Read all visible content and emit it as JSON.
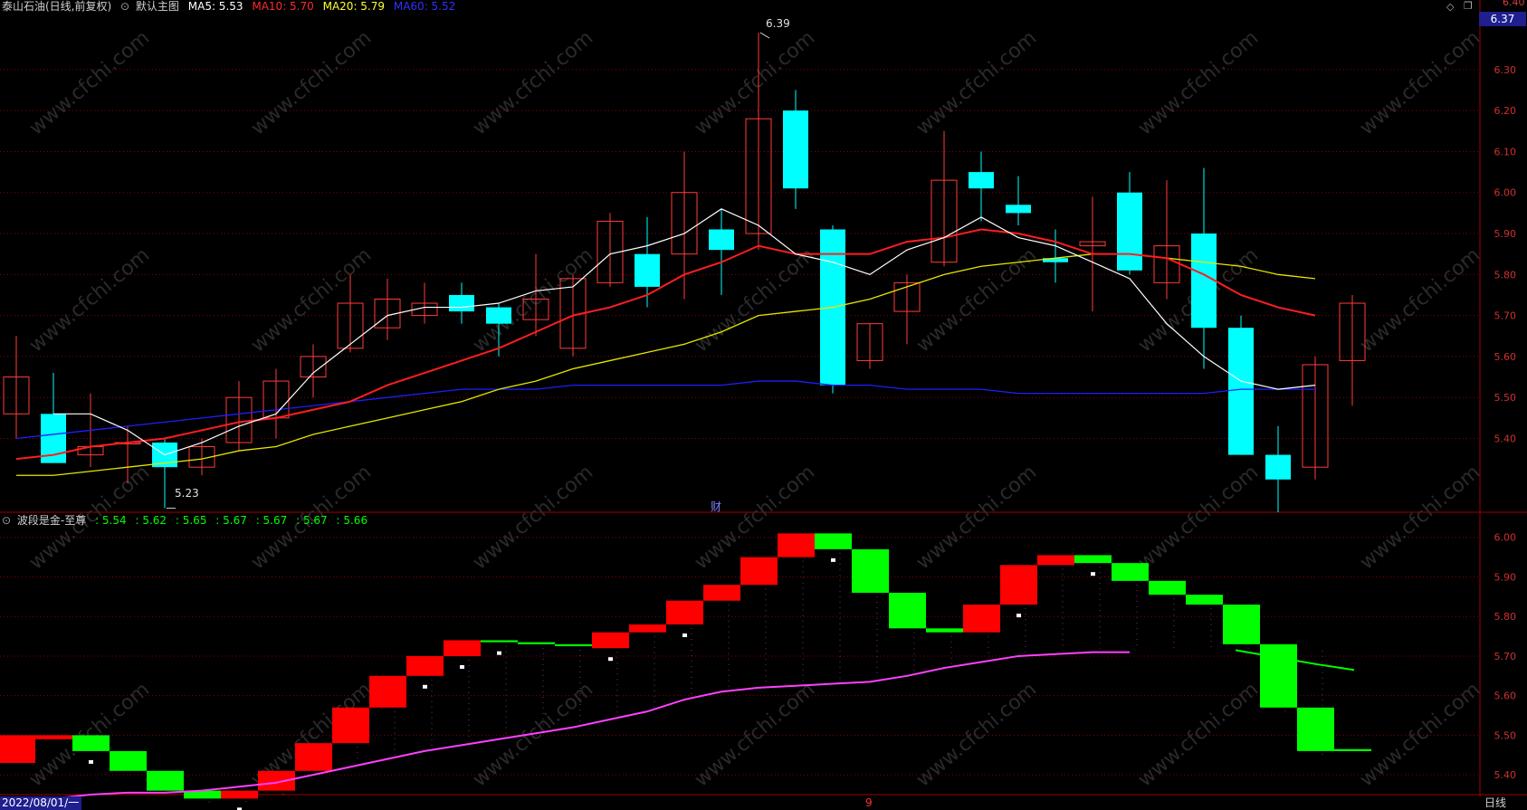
{
  "main_header": {
    "title": "泰山石油(日线,前复权)",
    "template": "默认主图",
    "ma5_label": "MA5: 5.53",
    "ma10_label": "MA10: 5.70",
    "ma20_label": "MA20: 5.79",
    "ma60_label": "MA60: 5.52"
  },
  "sub_header": {
    "title": "波段是金-至尊",
    "values": [
      ": 5.54",
      ": 5.62",
      ": 5.65",
      ": 5.67",
      ": 5.67",
      ": 5.67",
      ": 5.66"
    ]
  },
  "price_axis": {
    "current_price_box": "6.37",
    "top_partial_label": "6.40"
  },
  "bottom_bar": {
    "date_label": "2022/08/01/一",
    "month_marker": "9",
    "period_label": "日线"
  },
  "annotations": {
    "high_label": "6.39",
    "low_label": "5.23",
    "finance_marker": "财"
  },
  "watermark": "www.cfchi.com",
  "colors": {
    "up": "#ff3c3c",
    "down": "#00ffff",
    "ma5": "#ffffff",
    "ma10": "#ff1e1e",
    "ma20": "#e6e600",
    "ma60": "#1e1eff",
    "sub_up": "#ff0000",
    "sub_down": "#00ff00",
    "sub_line": "#ff40ff",
    "grid": "#8b0000"
  },
  "chart_data": [
    {
      "type": "candlestick",
      "x_index": [
        1,
        2,
        3,
        4,
        5,
        6,
        7,
        8,
        9,
        10,
        11,
        12,
        13,
        14,
        15,
        16,
        17,
        18,
        19,
        20,
        21,
        22,
        23,
        24,
        25,
        26,
        27,
        28,
        29,
        30,
        31,
        32,
        33,
        34,
        35,
        36,
        37,
        38,
        39,
        40
      ],
      "candles": [
        {
          "o": 5.46,
          "h": 5.65,
          "l": 5.4,
          "c": 5.55
        },
        {
          "o": 5.46,
          "h": 5.56,
          "l": 5.38,
          "c": 5.34
        },
        {
          "o": 5.36,
          "h": 5.51,
          "l": 5.33,
          "c": 5.38
        },
        {
          "o": 5.39,
          "h": 5.43,
          "l": 5.29,
          "c": 5.39
        },
        {
          "o": 5.39,
          "h": 5.4,
          "l": 5.23,
          "c": 5.33
        },
        {
          "o": 5.33,
          "h": 5.4,
          "l": 5.31,
          "c": 5.38
        },
        {
          "o": 5.39,
          "h": 5.54,
          "l": 5.37,
          "c": 5.5
        },
        {
          "o": 5.45,
          "h": 5.57,
          "l": 5.4,
          "c": 5.54
        },
        {
          "o": 5.55,
          "h": 5.63,
          "l": 5.5,
          "c": 5.6
        },
        {
          "o": 5.62,
          "h": 5.8,
          "l": 5.61,
          "c": 5.73
        },
        {
          "o": 5.67,
          "h": 5.79,
          "l": 5.64,
          "c": 5.74
        },
        {
          "o": 5.7,
          "h": 5.78,
          "l": 5.68,
          "c": 5.73
        },
        {
          "o": 5.75,
          "h": 5.78,
          "l": 5.68,
          "c": 5.71
        },
        {
          "o": 5.72,
          "h": 5.73,
          "l": 5.6,
          "c": 5.68
        },
        {
          "o": 5.69,
          "h": 5.85,
          "l": 5.65,
          "c": 5.74
        },
        {
          "o": 5.62,
          "h": 5.8,
          "l": 5.6,
          "c": 5.79
        },
        {
          "o": 5.78,
          "h": 5.95,
          "l": 5.77,
          "c": 5.93
        },
        {
          "o": 5.85,
          "h": 5.94,
          "l": 5.72,
          "c": 5.77
        },
        {
          "o": 5.85,
          "h": 6.1,
          "l": 5.74,
          "c": 6.0
        },
        {
          "o": 5.91,
          "h": 5.96,
          "l": 5.75,
          "c": 5.86
        },
        {
          "o": 5.9,
          "h": 6.39,
          "l": 5.86,
          "c": 6.18
        },
        {
          "o": 6.2,
          "h": 6.25,
          "l": 5.96,
          "c": 6.01
        },
        {
          "o": 5.91,
          "h": 5.92,
          "l": 5.51,
          "c": 5.53
        },
        {
          "o": 5.59,
          "h": 5.68,
          "l": 5.57,
          "c": 5.68
        },
        {
          "o": 5.71,
          "h": 5.8,
          "l": 5.63,
          "c": 5.78
        },
        {
          "o": 5.83,
          "h": 6.15,
          "l": 5.82,
          "c": 6.03
        },
        {
          "o": 6.05,
          "h": 6.1,
          "l": 5.93,
          "c": 6.01
        },
        {
          "o": 5.97,
          "h": 6.04,
          "l": 5.92,
          "c": 5.95
        },
        {
          "o": 5.84,
          "h": 5.91,
          "l": 5.78,
          "c": 5.83
        },
        {
          "o": 5.87,
          "h": 5.99,
          "l": 5.71,
          "c": 5.88
        },
        {
          "o": 6.0,
          "h": 6.05,
          "l": 5.8,
          "c": 5.81
        },
        {
          "o": 5.78,
          "h": 6.03,
          "l": 5.74,
          "c": 5.87
        },
        {
          "o": 5.9,
          "h": 6.06,
          "l": 5.57,
          "c": 5.67
        },
        {
          "o": 5.67,
          "h": 5.7,
          "l": 5.36,
          "c": 5.36
        },
        {
          "o": 5.36,
          "h": 5.43,
          "l": 5.22,
          "c": 5.3
        },
        {
          "o": 5.33,
          "h": 5.6,
          "l": 5.3,
          "c": 5.58
        },
        {
          "o": 5.59,
          "h": 5.75,
          "l": 5.48,
          "c": 5.73
        }
      ],
      "ma5": [
        5.46,
        5.46,
        5.42,
        5.36,
        5.39,
        5.43,
        5.46,
        5.56,
        5.63,
        5.7,
        5.72,
        5.72,
        5.73,
        5.76,
        5.77,
        5.85,
        5.87,
        5.9,
        5.96,
        5.92,
        5.85,
        5.83,
        5.8,
        5.86,
        5.89,
        5.94,
        5.89,
        5.87,
        5.83,
        5.79,
        5.68,
        5.6,
        5.54,
        5.52,
        5.53
      ],
      "ma5_start": 2,
      "ma10": [
        5.35,
        5.36,
        5.38,
        5.39,
        5.4,
        5.42,
        5.44,
        5.45,
        5.47,
        5.49,
        5.53,
        5.56,
        5.59,
        5.62,
        5.66,
        5.7,
        5.72,
        5.75,
        5.8,
        5.83,
        5.87,
        5.85,
        5.85,
        5.85,
        5.88,
        5.89,
        5.91,
        5.9,
        5.88,
        5.85,
        5.85,
        5.84,
        5.8,
        5.75,
        5.72,
        5.7
      ],
      "ma10_start": 1,
      "ma20": [
        5.31,
        5.31,
        5.32,
        5.33,
        5.34,
        5.35,
        5.37,
        5.38,
        5.41,
        5.43,
        5.45,
        5.47,
        5.49,
        5.52,
        5.54,
        5.57,
        5.59,
        5.61,
        5.63,
        5.66,
        5.7,
        5.71,
        5.72,
        5.74,
        5.77,
        5.8,
        5.82,
        5.83,
        5.84,
        5.85,
        5.85,
        5.84,
        5.83,
        5.82,
        5.8,
        5.79
      ],
      "ma20_start": 1,
      "ma60": [
        5.4,
        5.41,
        5.42,
        5.43,
        5.44,
        5.45,
        5.46,
        5.47,
        5.48,
        5.49,
        5.5,
        5.51,
        5.52,
        5.52,
        5.52,
        5.53,
        5.53,
        5.53,
        5.53,
        5.53,
        5.54,
        5.54,
        5.53,
        5.53,
        5.52,
        5.52,
        5.52,
        5.51,
        5.51,
        5.51,
        5.51,
        5.51,
        5.51,
        5.52,
        5.52,
        5.52
      ],
      "ma60_start": 1,
      "ylim": [
        5.22,
        6.43
      ],
      "yticks": [
        6.3,
        6.2,
        6.1,
        6.0,
        5.9,
        5.8,
        5.7,
        5.6,
        5.5,
        5.4
      ]
    },
    {
      "type": "step_bands",
      "bricks": [
        {
          "lo": 5.43,
          "hi": 5.5,
          "d": "up"
        },
        {
          "lo": 5.49,
          "hi": 5.5,
          "d": "up"
        },
        {
          "lo": 5.46,
          "hi": 5.5,
          "d": "down"
        },
        {
          "lo": 5.41,
          "hi": 5.46,
          "d": "down"
        },
        {
          "lo": 5.36,
          "hi": 5.41,
          "d": "down"
        },
        {
          "lo": 5.34,
          "hi": 5.36,
          "d": "down"
        },
        {
          "lo": 5.34,
          "hi": 5.36,
          "d": "up"
        },
        {
          "lo": 5.36,
          "hi": 5.41,
          "d": "up"
        },
        {
          "lo": 5.41,
          "hi": 5.48,
          "d": "up"
        },
        {
          "lo": 5.48,
          "hi": 5.57,
          "d": "up"
        },
        {
          "lo": 5.57,
          "hi": 5.65,
          "d": "up"
        },
        {
          "lo": 5.65,
          "hi": 5.7,
          "d": "up"
        },
        {
          "lo": 5.7,
          "hi": 5.74,
          "d": "up"
        },
        {
          "lo": 5.735,
          "hi": 5.74,
          "d": "down"
        },
        {
          "lo": 5.73,
          "hi": 5.735,
          "d": "down"
        },
        {
          "lo": 5.725,
          "hi": 5.73,
          "d": "down"
        },
        {
          "lo": 5.72,
          "hi": 5.76,
          "d": "up"
        },
        {
          "lo": 5.76,
          "hi": 5.78,
          "d": "up"
        },
        {
          "lo": 5.78,
          "hi": 5.84,
          "d": "up"
        },
        {
          "lo": 5.84,
          "hi": 5.88,
          "d": "up"
        },
        {
          "lo": 5.88,
          "hi": 5.95,
          "d": "up"
        },
        {
          "lo": 5.95,
          "hi": 6.01,
          "d": "up"
        },
        {
          "lo": 5.97,
          "hi": 6.01,
          "d": "down"
        },
        {
          "lo": 5.86,
          "hi": 5.97,
          "d": "down"
        },
        {
          "lo": 5.77,
          "hi": 5.86,
          "d": "down"
        },
        {
          "lo": 5.76,
          "hi": 5.77,
          "d": "down"
        },
        {
          "lo": 5.76,
          "hi": 5.83,
          "d": "up"
        },
        {
          "lo": 5.83,
          "hi": 5.93,
          "d": "up"
        },
        {
          "lo": 5.93,
          "hi": 5.955,
          "d": "up"
        },
        {
          "lo": 5.935,
          "hi": 5.955,
          "d": "down"
        },
        {
          "lo": 5.89,
          "hi": 5.935,
          "d": "down"
        },
        {
          "lo": 5.855,
          "hi": 5.89,
          "d": "down"
        },
        {
          "lo": 5.83,
          "hi": 5.855,
          "d": "down"
        },
        {
          "lo": 5.73,
          "hi": 5.83,
          "d": "down"
        },
        {
          "lo": 5.57,
          "hi": 5.73,
          "d": "down"
        },
        {
          "lo": 5.46,
          "hi": 5.57,
          "d": "down"
        },
        {
          "lo": 5.46,
          "hi": 5.465,
          "d": "down"
        }
      ],
      "magenta_line": [
        5.33,
        5.34,
        5.35,
        5.355,
        5.355,
        5.36,
        5.37,
        5.38,
        5.4,
        5.42,
        5.44,
        5.46,
        5.475,
        5.49,
        5.505,
        5.52,
        5.54,
        5.56,
        5.59,
        5.61,
        5.62,
        5.625,
        5.63,
        5.635,
        5.65,
        5.67,
        5.685,
        5.7,
        5.705,
        5.71,
        5.71
      ],
      "magenta_start": 1,
      "ylim": [
        5.35,
        6.02
      ],
      "yticks": [
        6.0,
        5.9,
        5.8,
        5.7,
        5.6,
        5.5,
        5.4
      ]
    }
  ]
}
